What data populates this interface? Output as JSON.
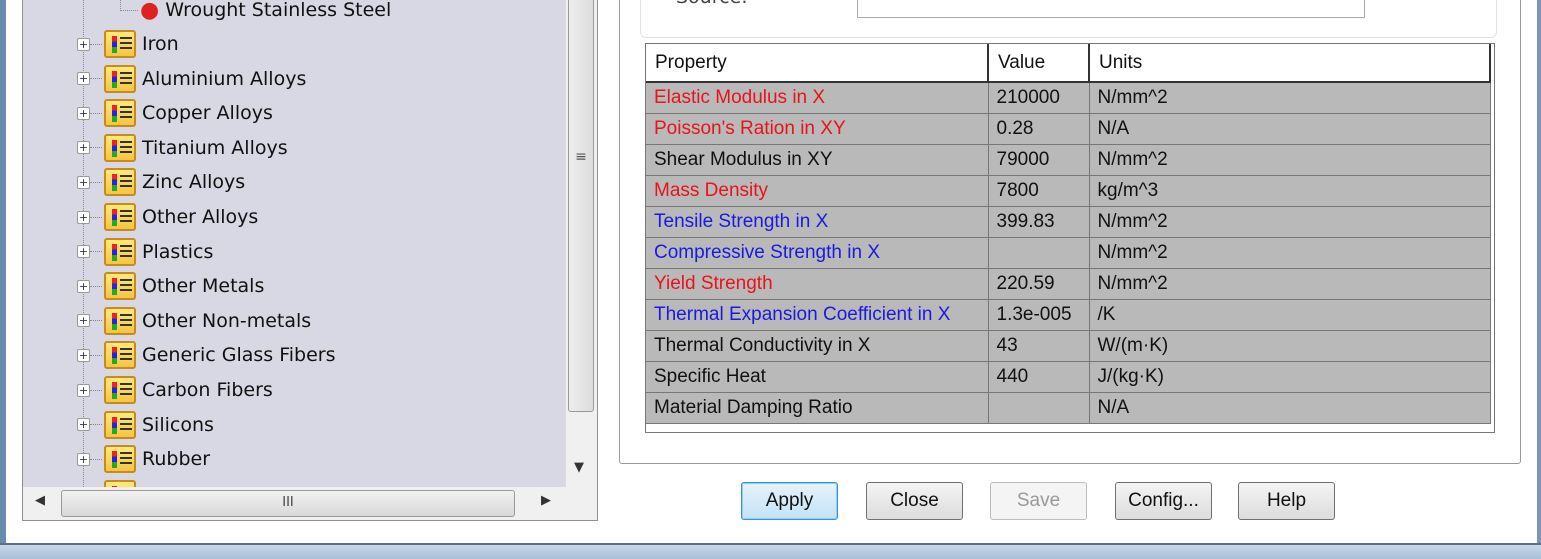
{
  "tree": {
    "child_item": "Wrought Stainless Steel",
    "items": [
      "Iron",
      "Aluminium Alloys",
      "Copper Alloys",
      "Titanium Alloys",
      "Zinc Alloys",
      "Other Alloys",
      "Plastics",
      "Other Metals",
      "Other Non-metals",
      "Generic Glass Fibers",
      "Carbon Fibers",
      "Silicons",
      "Rubber"
    ]
  },
  "source": {
    "label": "Source:",
    "value": ""
  },
  "table": {
    "headers": [
      "Property",
      "Value",
      "Units"
    ],
    "rows": [
      {
        "property": "Elastic Modulus in X",
        "value": "210000",
        "units": "N/mm^2",
        "color": "red"
      },
      {
        "property": "Poisson's Ration in XY",
        "value": "0.28",
        "units": "N/A",
        "color": "red"
      },
      {
        "property": "Shear Modulus in XY",
        "value": "79000",
        "units": "N/mm^2",
        "color": "black"
      },
      {
        "property": "Mass Density",
        "value": "7800",
        "units": "kg/m^3",
        "color": "red"
      },
      {
        "property": "Tensile Strength in X",
        "value": "399.83",
        "units": "N/mm^2",
        "color": "blue"
      },
      {
        "property": "Compressive Strength in X",
        "value": "",
        "units": "N/mm^2",
        "color": "blue"
      },
      {
        "property": "Yield Strength",
        "value": "220.59",
        "units": "N/mm^2",
        "color": "red"
      },
      {
        "property": "Thermal Expansion Coefficient in X",
        "value": "1.3e-005",
        "units": "/K",
        "color": "blue"
      },
      {
        "property": "Thermal Conductivity in X",
        "value": "43",
        "units": "W/(m·K)",
        "color": "black"
      },
      {
        "property": "Specific Heat",
        "value": "440",
        "units": "J/(kg·K)",
        "color": "black"
      },
      {
        "property": "Material Damping Ratio",
        "value": "",
        "units": "N/A",
        "color": "black"
      }
    ]
  },
  "buttons": {
    "apply": "Apply",
    "close": "Close",
    "save": "Save",
    "config": "Config...",
    "help": "Help"
  },
  "colors": {
    "required": "#e8131b",
    "optional": "#1a1ae0",
    "tree_bg": "#d7d8e3",
    "row_bg": "#b9b9b9"
  }
}
